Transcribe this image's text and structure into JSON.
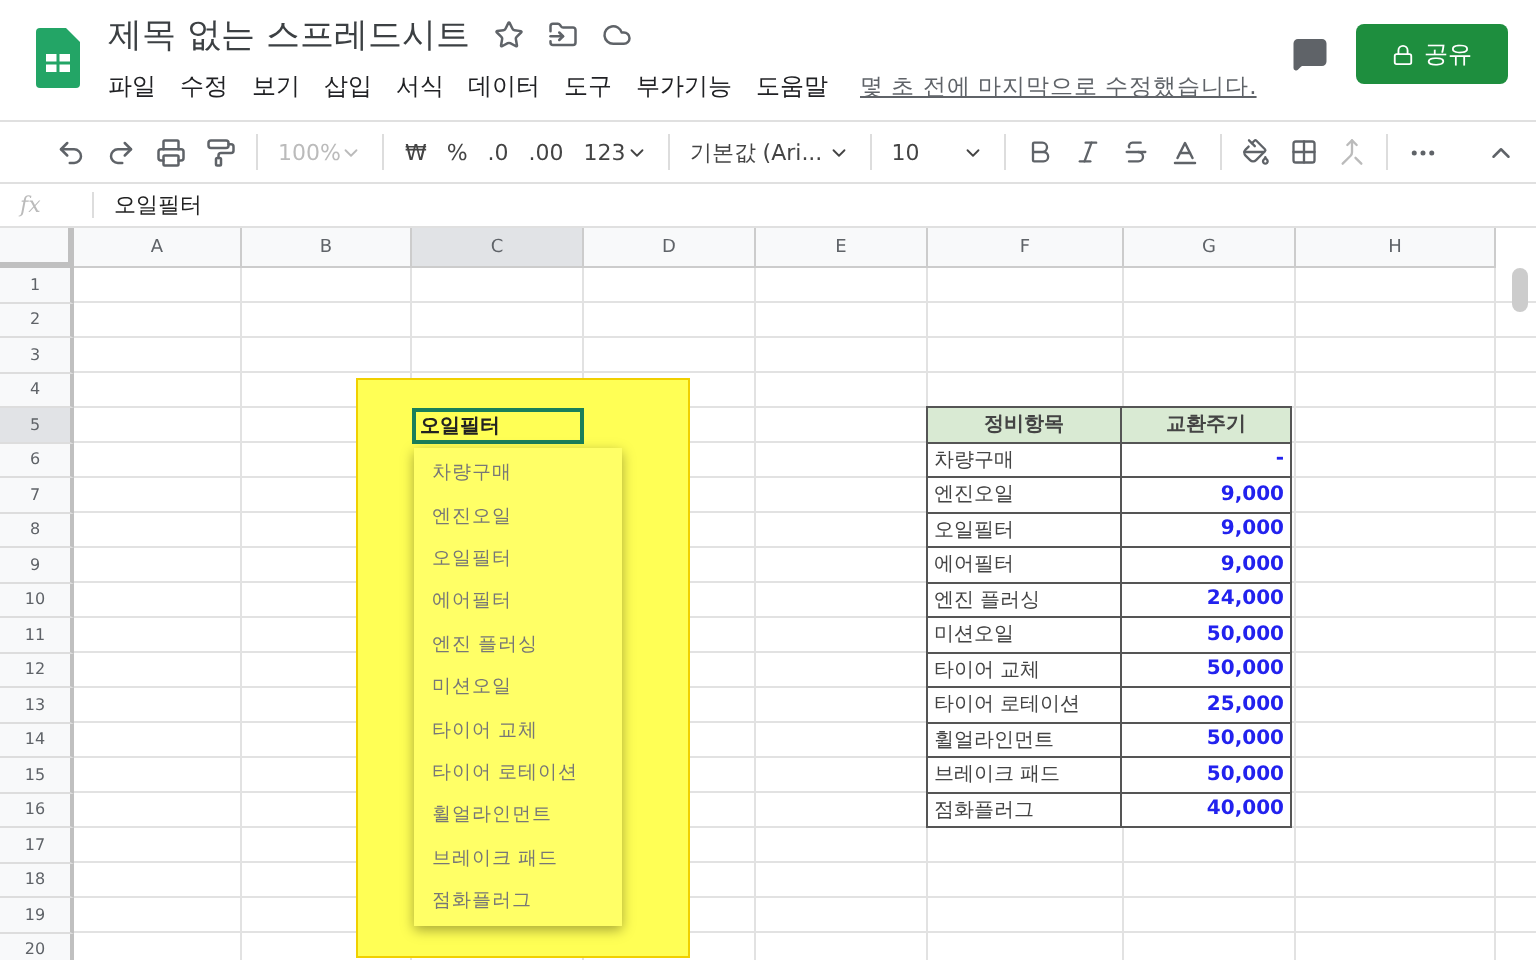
{
  "doc": {
    "title": "제목 없는 스프레드시트",
    "menu": [
      "파일",
      "수정",
      "보기",
      "삽입",
      "서식",
      "데이터",
      "도구",
      "부가기능",
      "도움말"
    ],
    "last_edit": "몇 초 전에 마지막으로 수정했습니다.",
    "share": "공유"
  },
  "toolbar": {
    "zoom": "100%",
    "currency": "₩",
    "percent": "%",
    "dec_less": ".0",
    "dec_more": ".00",
    "format": "123",
    "font": "기본값 (Ari...",
    "size": "10"
  },
  "formula_bar": {
    "label": "fx",
    "value": "오일필터"
  },
  "columns": [
    "A",
    "B",
    "C",
    "D",
    "E",
    "F",
    "G",
    "H"
  ],
  "rows": [
    "1",
    "2",
    "3",
    "4",
    "5",
    "6",
    "7",
    "8",
    "9",
    "10",
    "11",
    "12",
    "13",
    "14",
    "15",
    "16",
    "17",
    "18",
    "19",
    "20"
  ],
  "active_cell": {
    "value": "오일필터"
  },
  "dropdown": [
    "차량구매",
    "엔진오일",
    "오일필터",
    "에어필터",
    "엔진 플러싱",
    "미션오일",
    "타이어 교체",
    "타이어 로테이션",
    "휠얼라인먼트",
    "브레이크 패드",
    "점화플러그"
  ],
  "table": {
    "columns": [
      "정비항목",
      "교환주기"
    ],
    "rows": [
      [
        "차량구매",
        "-"
      ],
      [
        "엔진오일",
        "9,000"
      ],
      [
        "오일필터",
        "9,000"
      ],
      [
        "에어필터",
        "9,000"
      ],
      [
        "엔진 플러싱",
        "24,000"
      ],
      [
        "미션오일",
        "50,000"
      ],
      [
        "타이어 교체",
        "50,000"
      ],
      [
        "타이어 로테이션",
        "25,000"
      ],
      [
        "휠얼라인먼트",
        "50,000"
      ],
      [
        "브레이크 패드",
        "50,000"
      ],
      [
        "점화플러그",
        "40,000"
      ]
    ]
  }
}
